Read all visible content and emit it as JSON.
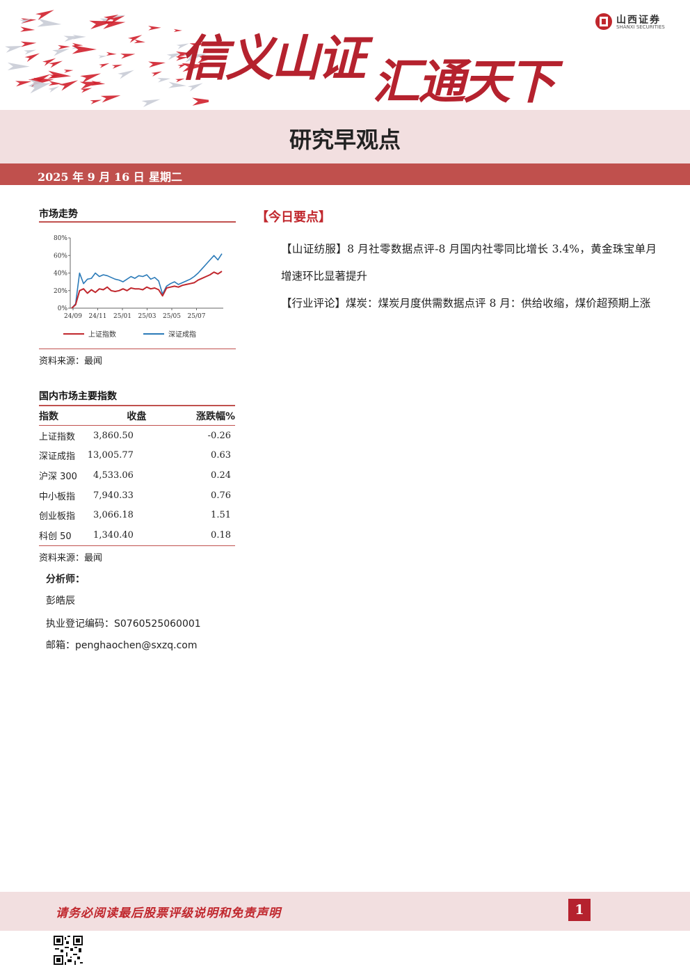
{
  "header": {
    "slogan_part1": "信义山证",
    "slogan_part2": "汇通天下",
    "logo_cn": "山西证券",
    "logo_en": "SHANXI SECURITIES"
  },
  "report_title": "研究早观点",
  "date": "2025 年 9 月 16 日",
  "weekday": "星期二",
  "market_trend": {
    "title": "市场走势",
    "source": "资料来源：最闻"
  },
  "chart_data": {
    "type": "line",
    "x": [
      "24/09",
      "24/11",
      "25/01",
      "25/03",
      "25/05",
      "25/07"
    ],
    "ylim": [
      0,
      80
    ],
    "yticks": [
      "0%",
      "20%",
      "40%",
      "60%",
      "80%"
    ],
    "series": [
      {
        "name": "上证指数",
        "color": "#c0272d",
        "values": [
          0,
          4,
          20,
          22,
          17,
          21,
          18,
          22,
          21,
          24,
          20,
          19,
          20,
          22,
          20,
          23,
          22,
          22,
          21,
          24,
          22,
          23,
          21,
          14,
          23,
          24,
          25,
          24,
          26,
          27,
          28,
          29,
          32,
          34,
          36,
          38,
          41,
          39,
          42
        ]
      },
      {
        "name": "深证成指",
        "color": "#2a7ab8",
        "values": [
          0,
          5,
          40,
          28,
          33,
          34,
          40,
          36,
          38,
          37,
          35,
          33,
          32,
          30,
          33,
          36,
          34,
          37,
          36,
          38,
          33,
          35,
          31,
          16,
          25,
          28,
          30,
          27,
          29,
          31,
          33,
          36,
          40,
          45,
          50,
          55,
          60,
          55,
          62
        ]
      }
    ]
  },
  "indices_table": {
    "title": "国内市场主要指数",
    "headers": [
      "指数",
      "收盘",
      "涨跌幅%"
    ],
    "rows": [
      {
        "name": "上证指数",
        "close": "3,860.50",
        "chg": "-0.26"
      },
      {
        "name": "深证成指",
        "close": "13,005.77",
        "chg": "0.63"
      },
      {
        "name": "沪深 300",
        "close": "4,533.06",
        "chg": "0.24"
      },
      {
        "name": "中小板指",
        "close": "7,940.33",
        "chg": "0.76"
      },
      {
        "name": "创业板指",
        "close": "3,066.18",
        "chg": "1.51"
      },
      {
        "name": "科创 50",
        "close": "1,340.40",
        "chg": "0.18"
      }
    ],
    "source": "资料来源：最闻"
  },
  "analyst": {
    "label": "分析师：",
    "name": "彭皓辰",
    "license": "执业登记编码：S0760525060001",
    "email": "邮箱：penghaochen@sxzq.com"
  },
  "key_points": {
    "title": "【今日要点】",
    "items": [
      {
        "tag": "【山证纺服】",
        "text": "8 月社零数据点评-8 月国内社零同比增长 3.4%，黄金珠宝单月增速环比显著提升"
      },
      {
        "tag": "【行业评论】",
        "text": "煤炭：煤炭月度供需数据点评 8 月：供给收缩，煤价超预期上涨"
      }
    ]
  },
  "footer": {
    "disclaimer": "请务必阅读最后股票评级说明和免责声明",
    "page": "1"
  }
}
